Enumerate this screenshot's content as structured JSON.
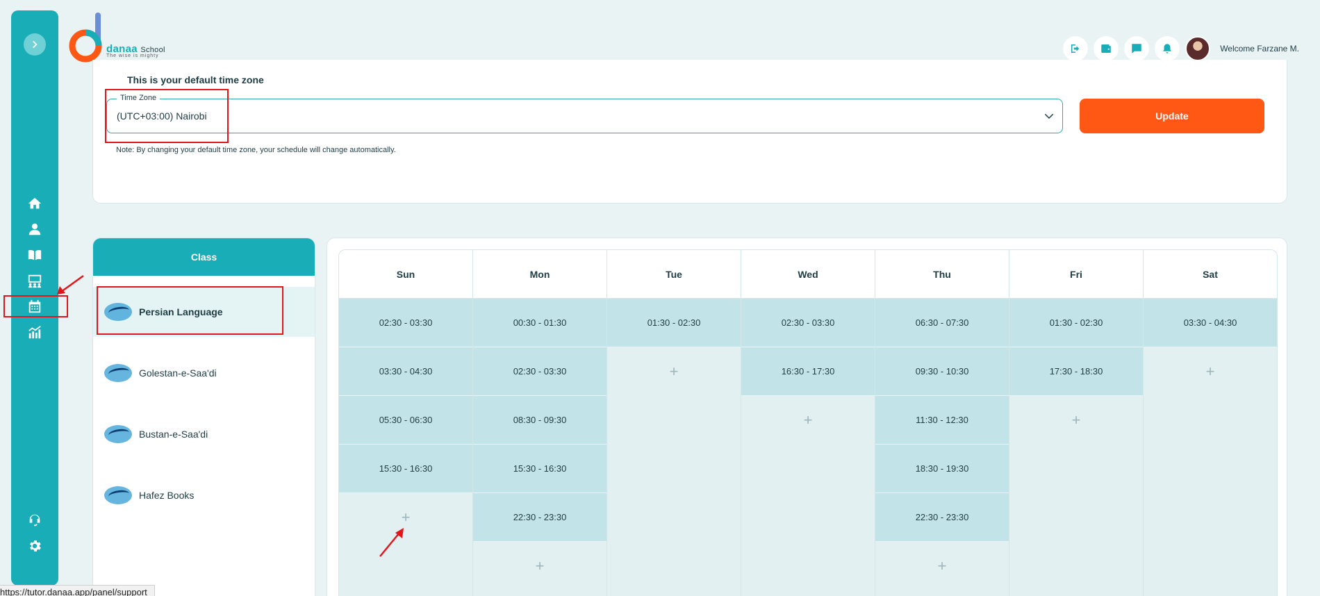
{
  "header": {
    "logo_word": "danaa",
    "logo_school": "School",
    "logo_tagline": "The wise is mighty",
    "welcome": "Welcome Farzane M."
  },
  "timezone": {
    "heading": "This is your default time zone",
    "legend": "Time Zone",
    "value": "(UTC+03:00) Nairobi",
    "update_label": "Update",
    "note": "Note: By changing your default time zone, your schedule will change automatically."
  },
  "classes": {
    "header": "Class",
    "items": [
      {
        "name": "Persian Language",
        "active": true
      },
      {
        "name": "Golestan-e-Saa'di",
        "active": false
      },
      {
        "name": "Bustan-e-Saa'di",
        "active": false
      },
      {
        "name": "Hafez Books",
        "active": false
      }
    ]
  },
  "schedule": {
    "add_symbol": "+",
    "days": [
      {
        "day": "Sun",
        "slots": [
          "02:30 - 03:30",
          "03:30 - 04:30",
          "05:30 - 06:30",
          "15:30 - 16:30"
        ]
      },
      {
        "day": "Mon",
        "slots": [
          "00:30 - 01:30",
          "02:30 - 03:30",
          "08:30 - 09:30",
          "15:30 - 16:30",
          "22:30 - 23:30"
        ]
      },
      {
        "day": "Tue",
        "slots": [
          "01:30 - 02:30"
        ]
      },
      {
        "day": "Wed",
        "slots": [
          "02:30 - 03:30",
          "16:30 - 17:30"
        ]
      },
      {
        "day": "Thu",
        "slots": [
          "06:30 - 07:30",
          "09:30 - 10:30",
          "11:30 - 12:30",
          "18:30 - 19:30",
          "22:30 - 23:30"
        ]
      },
      {
        "day": "Fri",
        "slots": [
          "01:30 - 02:30",
          "17:30 - 18:30"
        ]
      },
      {
        "day": "Sat",
        "slots": [
          "03:30 - 04:30"
        ]
      }
    ]
  },
  "status_url": "https://tutor.danaa.app/panel/support",
  "colors": {
    "brand": "#19adb8",
    "accent": "#ff5714",
    "annotation": "#e3151a"
  }
}
